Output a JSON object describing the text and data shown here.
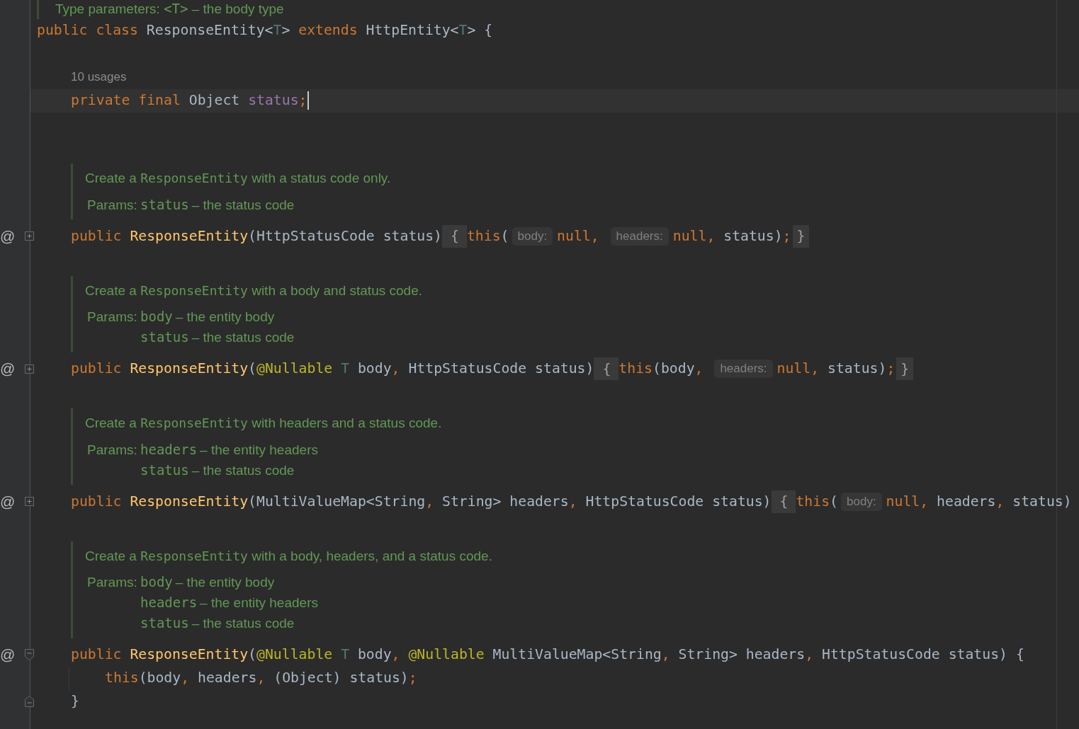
{
  "editor": {
    "doc_tail": [
      {
        "kind": "prose",
        "text": "Type parameters: "
      },
      {
        "kind": "code",
        "text": "<T>"
      },
      {
        "kind": "prose",
        "text": " – the body type"
      }
    ],
    "class_declaration": [
      {
        "text": "public ",
        "kind": "keyword"
      },
      {
        "text": "class ",
        "kind": "keyword"
      },
      {
        "text": "ResponseEntity<",
        "kind": "plain"
      },
      {
        "text": "T",
        "kind": "type_param"
      },
      {
        "text": "> ",
        "kind": "plain"
      },
      {
        "text": "extends ",
        "kind": "keyword"
      },
      {
        "text": "HttpEntity<",
        "kind": "plain"
      },
      {
        "text": "T",
        "kind": "type_param"
      },
      {
        "text": "> {",
        "kind": "plain"
      }
    ],
    "field": {
      "usages": "10 usages",
      "current": true,
      "caret": true,
      "tokens": [
        {
          "text": "private ",
          "kind": "keyword"
        },
        {
          "text": "final ",
          "kind": "keyword"
        },
        {
          "text": "Object ",
          "kind": "plain"
        },
        {
          "text": "status",
          "kind": "field"
        },
        {
          "text": ";",
          "kind": "punct"
        }
      ]
    },
    "constructors": [
      {
        "gutter_mark": "@",
        "folded": true,
        "doc": {
          "summary": [
            {
              "kind": "prose",
              "text": "Create a "
            },
            {
              "kind": "code",
              "text": "ResponseEntity"
            },
            {
              "kind": "prose",
              "text": " with a status code only."
            }
          ],
          "params_label": "Params:",
          "params": [
            {
              "name": "status",
              "description": "– the status code"
            }
          ]
        },
        "signature": [
          {
            "text": "public ",
            "kind": "keyword"
          },
          {
            "text": "ResponseEntity",
            "kind": "method"
          },
          {
            "text": "(HttpStatusCode status)",
            "kind": "plain"
          }
        ],
        "fold_open": "{",
        "fold_close": "}",
        "body": [
          [
            {
              "kind": "code",
              "tokens": [
                {
                  "text": "this",
                  "kind": "keyword"
                },
                {
                  "text": "(",
                  "kind": "plain"
                }
              ]
            },
            {
              "kind": "hint",
              "text": "body:"
            },
            {
              "kind": "code",
              "tokens": [
                {
                  "text": "null",
                  "kind": "keyword"
                },
                {
                  "text": ", ",
                  "kind": "punct"
                }
              ]
            },
            {
              "kind": "hint",
              "text": "headers:"
            },
            {
              "kind": "code",
              "tokens": [
                {
                  "text": "null",
                  "kind": "keyword"
                },
                {
                  "text": ", ",
                  "kind": "punct"
                },
                {
                  "text": "status)",
                  "kind": "plain"
                },
                {
                  "text": ";",
                  "kind": "punct"
                }
              ]
            }
          ]
        ]
      },
      {
        "gutter_mark": "@",
        "folded": true,
        "doc": {
          "summary": [
            {
              "kind": "prose",
              "text": "Create a "
            },
            {
              "kind": "code",
              "text": "ResponseEntity"
            },
            {
              "kind": "prose",
              "text": " with a body and status code."
            }
          ],
          "params_label": "Params:",
          "params": [
            {
              "name": "body",
              "description": "– the entity body"
            },
            {
              "name": "status",
              "description": "– the status code"
            }
          ]
        },
        "signature": [
          {
            "text": "public ",
            "kind": "keyword"
          },
          {
            "text": "ResponseEntity",
            "kind": "method"
          },
          {
            "text": "(",
            "kind": "plain"
          },
          {
            "text": "@Nullable ",
            "kind": "annotation"
          },
          {
            "text": "T ",
            "kind": "type_param"
          },
          {
            "text": "body",
            "kind": "plain"
          },
          {
            "text": ", ",
            "kind": "punct"
          },
          {
            "text": "HttpStatusCode status)",
            "kind": "plain"
          }
        ],
        "fold_open": "{",
        "fold_close": "}",
        "body": [
          [
            {
              "kind": "code",
              "tokens": [
                {
                  "text": "this",
                  "kind": "keyword"
                },
                {
                  "text": "(body",
                  "kind": "plain"
                },
                {
                  "text": ", ",
                  "kind": "punct"
                }
              ]
            },
            {
              "kind": "hint",
              "text": "headers:"
            },
            {
              "kind": "code",
              "tokens": [
                {
                  "text": "null",
                  "kind": "keyword"
                },
                {
                  "text": ", ",
                  "kind": "punct"
                },
                {
                  "text": "status)",
                  "kind": "plain"
                },
                {
                  "text": ";",
                  "kind": "punct"
                }
              ]
            }
          ]
        ]
      },
      {
        "gutter_mark": "@",
        "folded": true,
        "doc": {
          "summary": [
            {
              "kind": "prose",
              "text": "Create a "
            },
            {
              "kind": "code",
              "text": "ResponseEntity"
            },
            {
              "kind": "prose",
              "text": " with headers and a status code."
            }
          ],
          "params_label": "Params:",
          "params": [
            {
              "name": "headers",
              "description": "– the entity headers"
            },
            {
              "name": "status",
              "description": "– the status code"
            }
          ]
        },
        "signature": [
          {
            "text": "public ",
            "kind": "keyword"
          },
          {
            "text": "ResponseEntity",
            "kind": "method"
          },
          {
            "text": "(MultiValueMap<String",
            "kind": "plain"
          },
          {
            "text": ", ",
            "kind": "punct"
          },
          {
            "text": "String> headers",
            "kind": "plain"
          },
          {
            "text": ", ",
            "kind": "punct"
          },
          {
            "text": "HttpStatusCode status)",
            "kind": "plain"
          }
        ],
        "fold_open": "{",
        "body": [
          [
            {
              "kind": "code",
              "tokens": [
                {
                  "text": "this",
                  "kind": "keyword"
                },
                {
                  "text": "(",
                  "kind": "plain"
                }
              ]
            },
            {
              "kind": "hint",
              "text": "body:"
            },
            {
              "kind": "code",
              "tokens": [
                {
                  "text": "null",
                  "kind": "keyword"
                },
                {
                  "text": ", ",
                  "kind": "punct"
                },
                {
                  "text": "headers",
                  "kind": "plain"
                },
                {
                  "text": ", ",
                  "kind": "punct"
                },
                {
                  "text": "status)",
                  "kind": "plain"
                }
              ]
            }
          ]
        ]
      },
      {
        "gutter_mark": "@",
        "folded": false,
        "doc": {
          "summary": [
            {
              "kind": "prose",
              "text": "Create a "
            },
            {
              "kind": "code",
              "text": "ResponseEntity"
            },
            {
              "kind": "prose",
              "text": " with a body, headers, and a status code."
            }
          ],
          "params_label": "Params:",
          "params": [
            {
              "name": "body",
              "description": "– the entity body"
            },
            {
              "name": "headers",
              "description": "– the entity headers"
            },
            {
              "name": "status",
              "description": "– the status code"
            }
          ]
        },
        "signature": [
          {
            "text": "public ",
            "kind": "keyword"
          },
          {
            "text": "ResponseEntity",
            "kind": "method"
          },
          {
            "text": "(",
            "kind": "plain"
          },
          {
            "text": "@Nullable ",
            "kind": "annotation"
          },
          {
            "text": "T ",
            "kind": "type_param"
          },
          {
            "text": "body",
            "kind": "plain"
          },
          {
            "text": ", ",
            "kind": "punct"
          },
          {
            "text": "@Nullable ",
            "kind": "annotation"
          },
          {
            "text": "MultiValueMap<String",
            "kind": "plain"
          },
          {
            "text": ", ",
            "kind": "punct"
          },
          {
            "text": "String> headers",
            "kind": "plain"
          },
          {
            "text": ", ",
            "kind": "punct"
          },
          {
            "text": "HttpStatusCode status) {",
            "kind": "plain"
          }
        ],
        "body": [
          [
            {
              "kind": "code",
              "tokens": [
                {
                  "text": "this",
                  "kind": "keyword"
                },
                {
                  "text": "(body",
                  "kind": "plain"
                },
                {
                  "text": ", ",
                  "kind": "punct"
                },
                {
                  "text": "headers",
                  "kind": "plain"
                },
                {
                  "text": ", ",
                  "kind": "punct"
                },
                {
                  "text": "(Object) status)",
                  "kind": "plain"
                },
                {
                  "text": ";",
                  "kind": "punct"
                }
              ]
            }
          ]
        ],
        "closing": [
          {
            "text": "}",
            "kind": "plain"
          }
        ]
      }
    ]
  }
}
